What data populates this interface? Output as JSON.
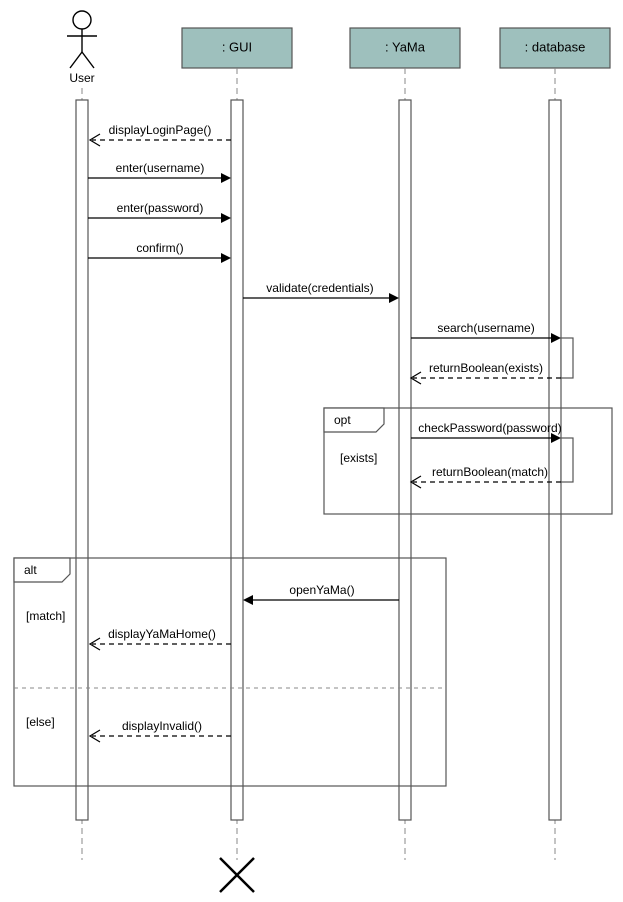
{
  "actor": {
    "name": "User"
  },
  "lifelines": {
    "gui": ": GUI",
    "yama": ": YaMa",
    "db": ": database"
  },
  "messages": {
    "m1": "displayLoginPage()",
    "m2": "enter(username)",
    "m3": "enter(password)",
    "m4": "confirm()",
    "m5": "validate(credentials)",
    "m6": "search(username)",
    "m7": "returnBoolean(exists)",
    "m8": "checkPassword(password)",
    "m9": "returnBoolean(match)",
    "m10": "openYaMa()",
    "m11": "displayYaMaHome()",
    "m12": "displayInvalid()"
  },
  "frames": {
    "opt": {
      "tag": "opt",
      "guard": "[exists]"
    },
    "alt": {
      "tag": "alt",
      "guard1": "[match]",
      "guard2": "[else]"
    }
  }
}
